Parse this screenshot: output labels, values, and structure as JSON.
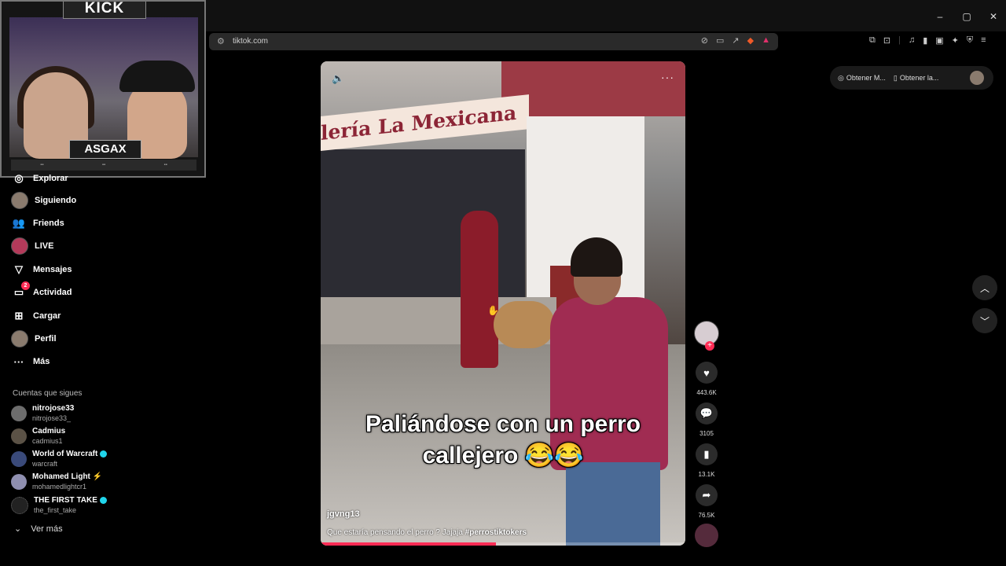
{
  "browser": {
    "url": "tiktok.com",
    "window_controls": [
      "–",
      "▢",
      "✕"
    ]
  },
  "stream_overlay": {
    "platform_label": "KICK",
    "streamer_name": "ASGAX"
  },
  "sidebar": {
    "items": [
      {
        "label": "Explorar",
        "icon": "compass-icon"
      },
      {
        "label": "Siguiendo",
        "icon": "avatar"
      },
      {
        "label": "Friends",
        "icon": "friends-icon"
      },
      {
        "label": "LIVE",
        "icon": "live-icon"
      },
      {
        "label": "Mensajes",
        "icon": "paper-plane-icon"
      },
      {
        "label": "Actividad",
        "icon": "activity-icon",
        "badge": "2"
      },
      {
        "label": "Cargar",
        "icon": "plus-square-icon"
      },
      {
        "label": "Perfil",
        "icon": "avatar"
      },
      {
        "label": "Más",
        "icon": "more-icon"
      }
    ],
    "following_title": "Cuentas que sigues",
    "following": [
      {
        "name": "nitrojose33",
        "username": "nitrojose33_"
      },
      {
        "name": "Cadmius",
        "username": "cadmius1"
      },
      {
        "name": "World of Warcraft",
        "username": "warcraft",
        "verified": true
      },
      {
        "name": "Mohamed Light ⚡",
        "username": "mohamedlightcr1"
      },
      {
        "name": "THE FIRST TAKE",
        "username": "the_first_take",
        "verified": true
      }
    ],
    "see_more": "Ver más"
  },
  "video": {
    "sign_text": "lería La Mexicana",
    "caption_line1": "Paliándose con un perro",
    "caption_line2": "callejero 😂😂",
    "author": "jgvng13",
    "description": "Que estaría pensando el perro ? Jajaja ",
    "hashtag": "#perrostiktokers",
    "progress": 0.48
  },
  "actions": {
    "likes": "443.6K",
    "comments": "3105",
    "saves": "13.1K",
    "shares": "76.5K"
  },
  "top_right": {
    "button1": "Obtener M...",
    "button2": "Obtener la..."
  },
  "colors": {
    "accent": "#fe2c55",
    "verified": "#20d5ec"
  }
}
